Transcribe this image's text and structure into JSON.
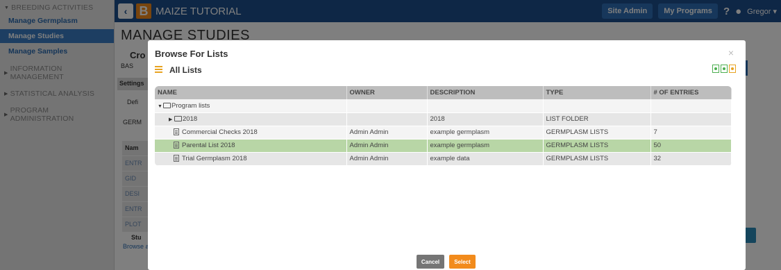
{
  "sidebar": {
    "groups": [
      {
        "label": "BREEDING ACTIVITIES",
        "expanded": true
      },
      {
        "label": "INFORMATION MANAGEMENT",
        "expanded": false
      },
      {
        "label": "STATISTICAL ANALYSIS",
        "expanded": false
      },
      {
        "label": "PROGRAM ADMINISTRATION",
        "expanded": false
      }
    ],
    "items": [
      {
        "label": "Manage Germplasm",
        "active": false
      },
      {
        "label": "Manage Studies",
        "active": true
      },
      {
        "label": "Manage Samples",
        "active": false
      }
    ]
  },
  "topbar": {
    "logo_letter": "B",
    "app_title": "MAIZE TUTORIAL",
    "site_admin": "Site Admin",
    "my_programs": "My Programs",
    "user": "Gregor"
  },
  "background": {
    "page_title": "MANAGE STUDIES",
    "crop_label": "Cro",
    "basic_label": "BAS",
    "settings_tab": "Settings",
    "defi": "Defi",
    "germ": "GERM",
    "name_col": "Nam",
    "rows": [
      "ENTR",
      "GID",
      "DESI",
      "ENTR",
      "PLOT"
    ],
    "stud": "Stu",
    "browse": "Browse a"
  },
  "modal": {
    "title": "Browse For Lists",
    "close": "×",
    "section_title": "All Lists",
    "columns": [
      "NAME",
      "OWNER",
      "DESCRIPTION",
      "TYPE",
      "# OF ENTRIES"
    ],
    "rows": [
      {
        "name": "Program lists",
        "owner": "",
        "description": "",
        "type": "",
        "entries": ""
      },
      {
        "name": "2018",
        "owner": "",
        "description": "2018",
        "type": "LIST FOLDER",
        "entries": ""
      },
      {
        "name": "Commercial Checks 2018",
        "owner": "Admin Admin",
        "description": "example germplasm",
        "type": "GERMPLASM LISTS",
        "entries": "7"
      },
      {
        "name": "Parental List 2018",
        "owner": "Admin Admin",
        "description": "example germplasm",
        "type": "GERMPLASM LISTS",
        "entries": "50"
      },
      {
        "name": "Trial Germplasm 2018",
        "owner": "Admin Admin",
        "description": "example data",
        "type": "GERMPLASM LISTS",
        "entries": "32"
      }
    ],
    "cancel": "Cancel",
    "select": "Select"
  },
  "colors": {
    "topbar": "#1d4f8c",
    "accent_orange": "#f28b1c",
    "selected_row": "#b8d6a6",
    "sidebar_active": "#3a7dc4"
  }
}
